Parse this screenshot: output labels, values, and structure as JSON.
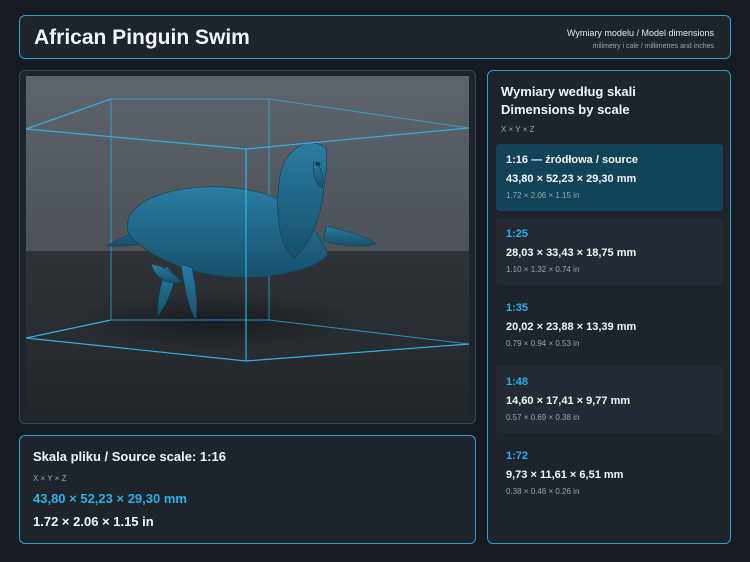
{
  "header": {
    "title": "African Pinguin Swim",
    "subtitle": "Wymiary modelu / Model dimensions",
    "units_note": "milimetry i cale / millimetres and inches"
  },
  "source": {
    "title": "Skala pliku / Source scale: 1:16",
    "axes": "X × Y × Z",
    "mm": "43,80 × 52,23 × 29,30 mm",
    "inches": "1.72 × 2.06 × 1.15 in"
  },
  "scales_panel": {
    "title_pl": "Wymiary według skali",
    "title_en": "Dimensions by scale",
    "axes": "X × Y × Z",
    "items": [
      {
        "label": "1:16  —  źródłowa / source",
        "mm": "43,80 × 52,23 × 29,30 mm",
        "inches": "1.72 × 2.06 × 1.15 in"
      },
      {
        "label": "1:25",
        "mm": "28,03 × 33,43 × 18,75 mm",
        "inches": "1.10 × 1.32 × 0.74 in"
      },
      {
        "label": "1:35",
        "mm": "20,02 × 23,88 × 13,39 mm",
        "inches": "0.79 × 0.94 × 0.53 in"
      },
      {
        "label": "1:48",
        "mm": "14,60 × 17,41 × 9,77 mm",
        "inches": "0.57 × 0.69 × 0.38 in"
      },
      {
        "label": "1:72",
        "mm": "9,73 × 11,61 × 6,51 mm",
        "inches": "0.38 × 0.46 × 0.26 in"
      }
    ]
  },
  "colors": {
    "accent": "#2fb0e6",
    "border": "#2aa0cc",
    "active_card": "#124459",
    "model": "#1f6585"
  }
}
